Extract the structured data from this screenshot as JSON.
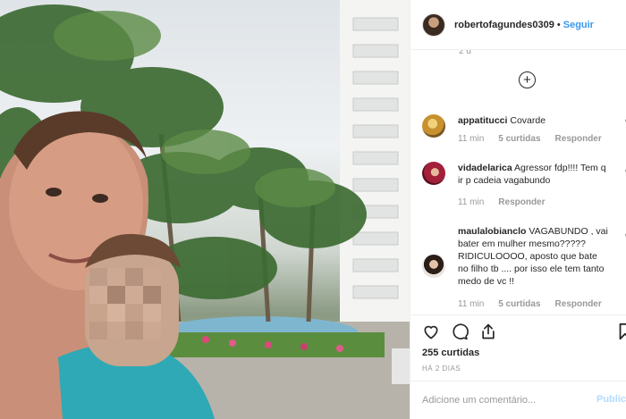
{
  "post": {
    "username": "robertofagundes0309",
    "separator": "•",
    "follow_label": "Seguir",
    "cut_timestamp": "2 d",
    "load_more_icon": "plus-circle-icon",
    "likes": "255 curtidas",
    "posted_ago": "HÁ 2 DIAS",
    "comment_placeholder": "Adicione um comentário...",
    "publish_label": "Publicar"
  },
  "comments": [
    {
      "username": "appatitucci",
      "text": "Covarde",
      "time": "11 min",
      "likes": "5 curtidas",
      "reply": "Responder",
      "avatar_color": "#c8912f"
    },
    {
      "username": "vidadelarica",
      "text": "Agressor fdp!!!! Tem q ir p cadeia vagabundo",
      "time": "11 min",
      "reply": "Responder",
      "avatar_color": "#a3203a"
    },
    {
      "username": "maulalobianclo",
      "text": "VAGABUNDO , vai bater em mulher mesmo????? RIDICULOOOO, aposto que bate no filho tb .... por isso ele tem tanto medo de vc !!",
      "time": "11 min",
      "likes": "5 curtidas",
      "reply": "Responder",
      "avatar_color": "#5a4a44"
    }
  ],
  "icons": {
    "like": "heart-icon",
    "comment": "comment-icon",
    "share": "share-icon",
    "save": "bookmark-icon"
  }
}
